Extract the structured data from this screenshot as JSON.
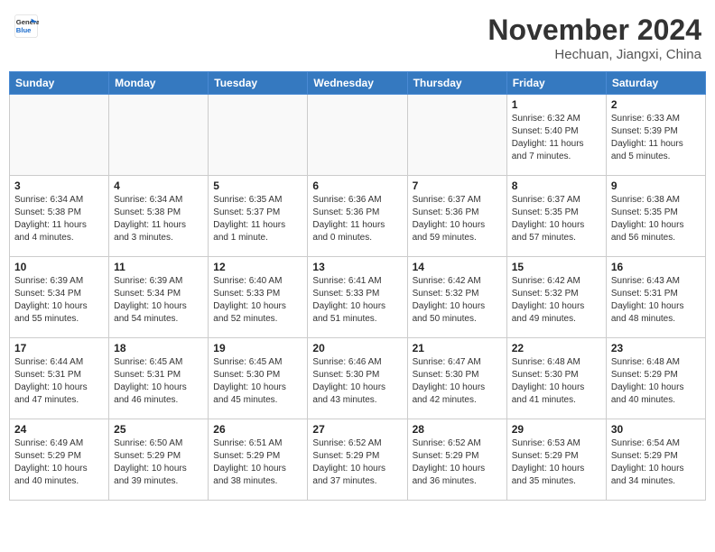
{
  "header": {
    "logo_line1": "General",
    "logo_line2": "Blue",
    "month_year": "November 2024",
    "location": "Hechuan, Jiangxi, China"
  },
  "weekdays": [
    "Sunday",
    "Monday",
    "Tuesday",
    "Wednesday",
    "Thursday",
    "Friday",
    "Saturday"
  ],
  "weeks": [
    [
      {
        "day": "",
        "info": ""
      },
      {
        "day": "",
        "info": ""
      },
      {
        "day": "",
        "info": ""
      },
      {
        "day": "",
        "info": ""
      },
      {
        "day": "",
        "info": ""
      },
      {
        "day": "1",
        "info": "Sunrise: 6:32 AM\nSunset: 5:40 PM\nDaylight: 11 hours and 7 minutes."
      },
      {
        "day": "2",
        "info": "Sunrise: 6:33 AM\nSunset: 5:39 PM\nDaylight: 11 hours and 5 minutes."
      }
    ],
    [
      {
        "day": "3",
        "info": "Sunrise: 6:34 AM\nSunset: 5:38 PM\nDaylight: 11 hours and 4 minutes."
      },
      {
        "day": "4",
        "info": "Sunrise: 6:34 AM\nSunset: 5:38 PM\nDaylight: 11 hours and 3 minutes."
      },
      {
        "day": "5",
        "info": "Sunrise: 6:35 AM\nSunset: 5:37 PM\nDaylight: 11 hours and 1 minute."
      },
      {
        "day": "6",
        "info": "Sunrise: 6:36 AM\nSunset: 5:36 PM\nDaylight: 11 hours and 0 minutes."
      },
      {
        "day": "7",
        "info": "Sunrise: 6:37 AM\nSunset: 5:36 PM\nDaylight: 10 hours and 59 minutes."
      },
      {
        "day": "8",
        "info": "Sunrise: 6:37 AM\nSunset: 5:35 PM\nDaylight: 10 hours and 57 minutes."
      },
      {
        "day": "9",
        "info": "Sunrise: 6:38 AM\nSunset: 5:35 PM\nDaylight: 10 hours and 56 minutes."
      }
    ],
    [
      {
        "day": "10",
        "info": "Sunrise: 6:39 AM\nSunset: 5:34 PM\nDaylight: 10 hours and 55 minutes."
      },
      {
        "day": "11",
        "info": "Sunrise: 6:39 AM\nSunset: 5:34 PM\nDaylight: 10 hours and 54 minutes."
      },
      {
        "day": "12",
        "info": "Sunrise: 6:40 AM\nSunset: 5:33 PM\nDaylight: 10 hours and 52 minutes."
      },
      {
        "day": "13",
        "info": "Sunrise: 6:41 AM\nSunset: 5:33 PM\nDaylight: 10 hours and 51 minutes."
      },
      {
        "day": "14",
        "info": "Sunrise: 6:42 AM\nSunset: 5:32 PM\nDaylight: 10 hours and 50 minutes."
      },
      {
        "day": "15",
        "info": "Sunrise: 6:42 AM\nSunset: 5:32 PM\nDaylight: 10 hours and 49 minutes."
      },
      {
        "day": "16",
        "info": "Sunrise: 6:43 AM\nSunset: 5:31 PM\nDaylight: 10 hours and 48 minutes."
      }
    ],
    [
      {
        "day": "17",
        "info": "Sunrise: 6:44 AM\nSunset: 5:31 PM\nDaylight: 10 hours and 47 minutes."
      },
      {
        "day": "18",
        "info": "Sunrise: 6:45 AM\nSunset: 5:31 PM\nDaylight: 10 hours and 46 minutes."
      },
      {
        "day": "19",
        "info": "Sunrise: 6:45 AM\nSunset: 5:30 PM\nDaylight: 10 hours and 45 minutes."
      },
      {
        "day": "20",
        "info": "Sunrise: 6:46 AM\nSunset: 5:30 PM\nDaylight: 10 hours and 43 minutes."
      },
      {
        "day": "21",
        "info": "Sunrise: 6:47 AM\nSunset: 5:30 PM\nDaylight: 10 hours and 42 minutes."
      },
      {
        "day": "22",
        "info": "Sunrise: 6:48 AM\nSunset: 5:30 PM\nDaylight: 10 hours and 41 minutes."
      },
      {
        "day": "23",
        "info": "Sunrise: 6:48 AM\nSunset: 5:29 PM\nDaylight: 10 hours and 40 minutes."
      }
    ],
    [
      {
        "day": "24",
        "info": "Sunrise: 6:49 AM\nSunset: 5:29 PM\nDaylight: 10 hours and 40 minutes."
      },
      {
        "day": "25",
        "info": "Sunrise: 6:50 AM\nSunset: 5:29 PM\nDaylight: 10 hours and 39 minutes."
      },
      {
        "day": "26",
        "info": "Sunrise: 6:51 AM\nSunset: 5:29 PM\nDaylight: 10 hours and 38 minutes."
      },
      {
        "day": "27",
        "info": "Sunrise: 6:52 AM\nSunset: 5:29 PM\nDaylight: 10 hours and 37 minutes."
      },
      {
        "day": "28",
        "info": "Sunrise: 6:52 AM\nSunset: 5:29 PM\nDaylight: 10 hours and 36 minutes."
      },
      {
        "day": "29",
        "info": "Sunrise: 6:53 AM\nSunset: 5:29 PM\nDaylight: 10 hours and 35 minutes."
      },
      {
        "day": "30",
        "info": "Sunrise: 6:54 AM\nSunset: 5:29 PM\nDaylight: 10 hours and 34 minutes."
      }
    ]
  ]
}
